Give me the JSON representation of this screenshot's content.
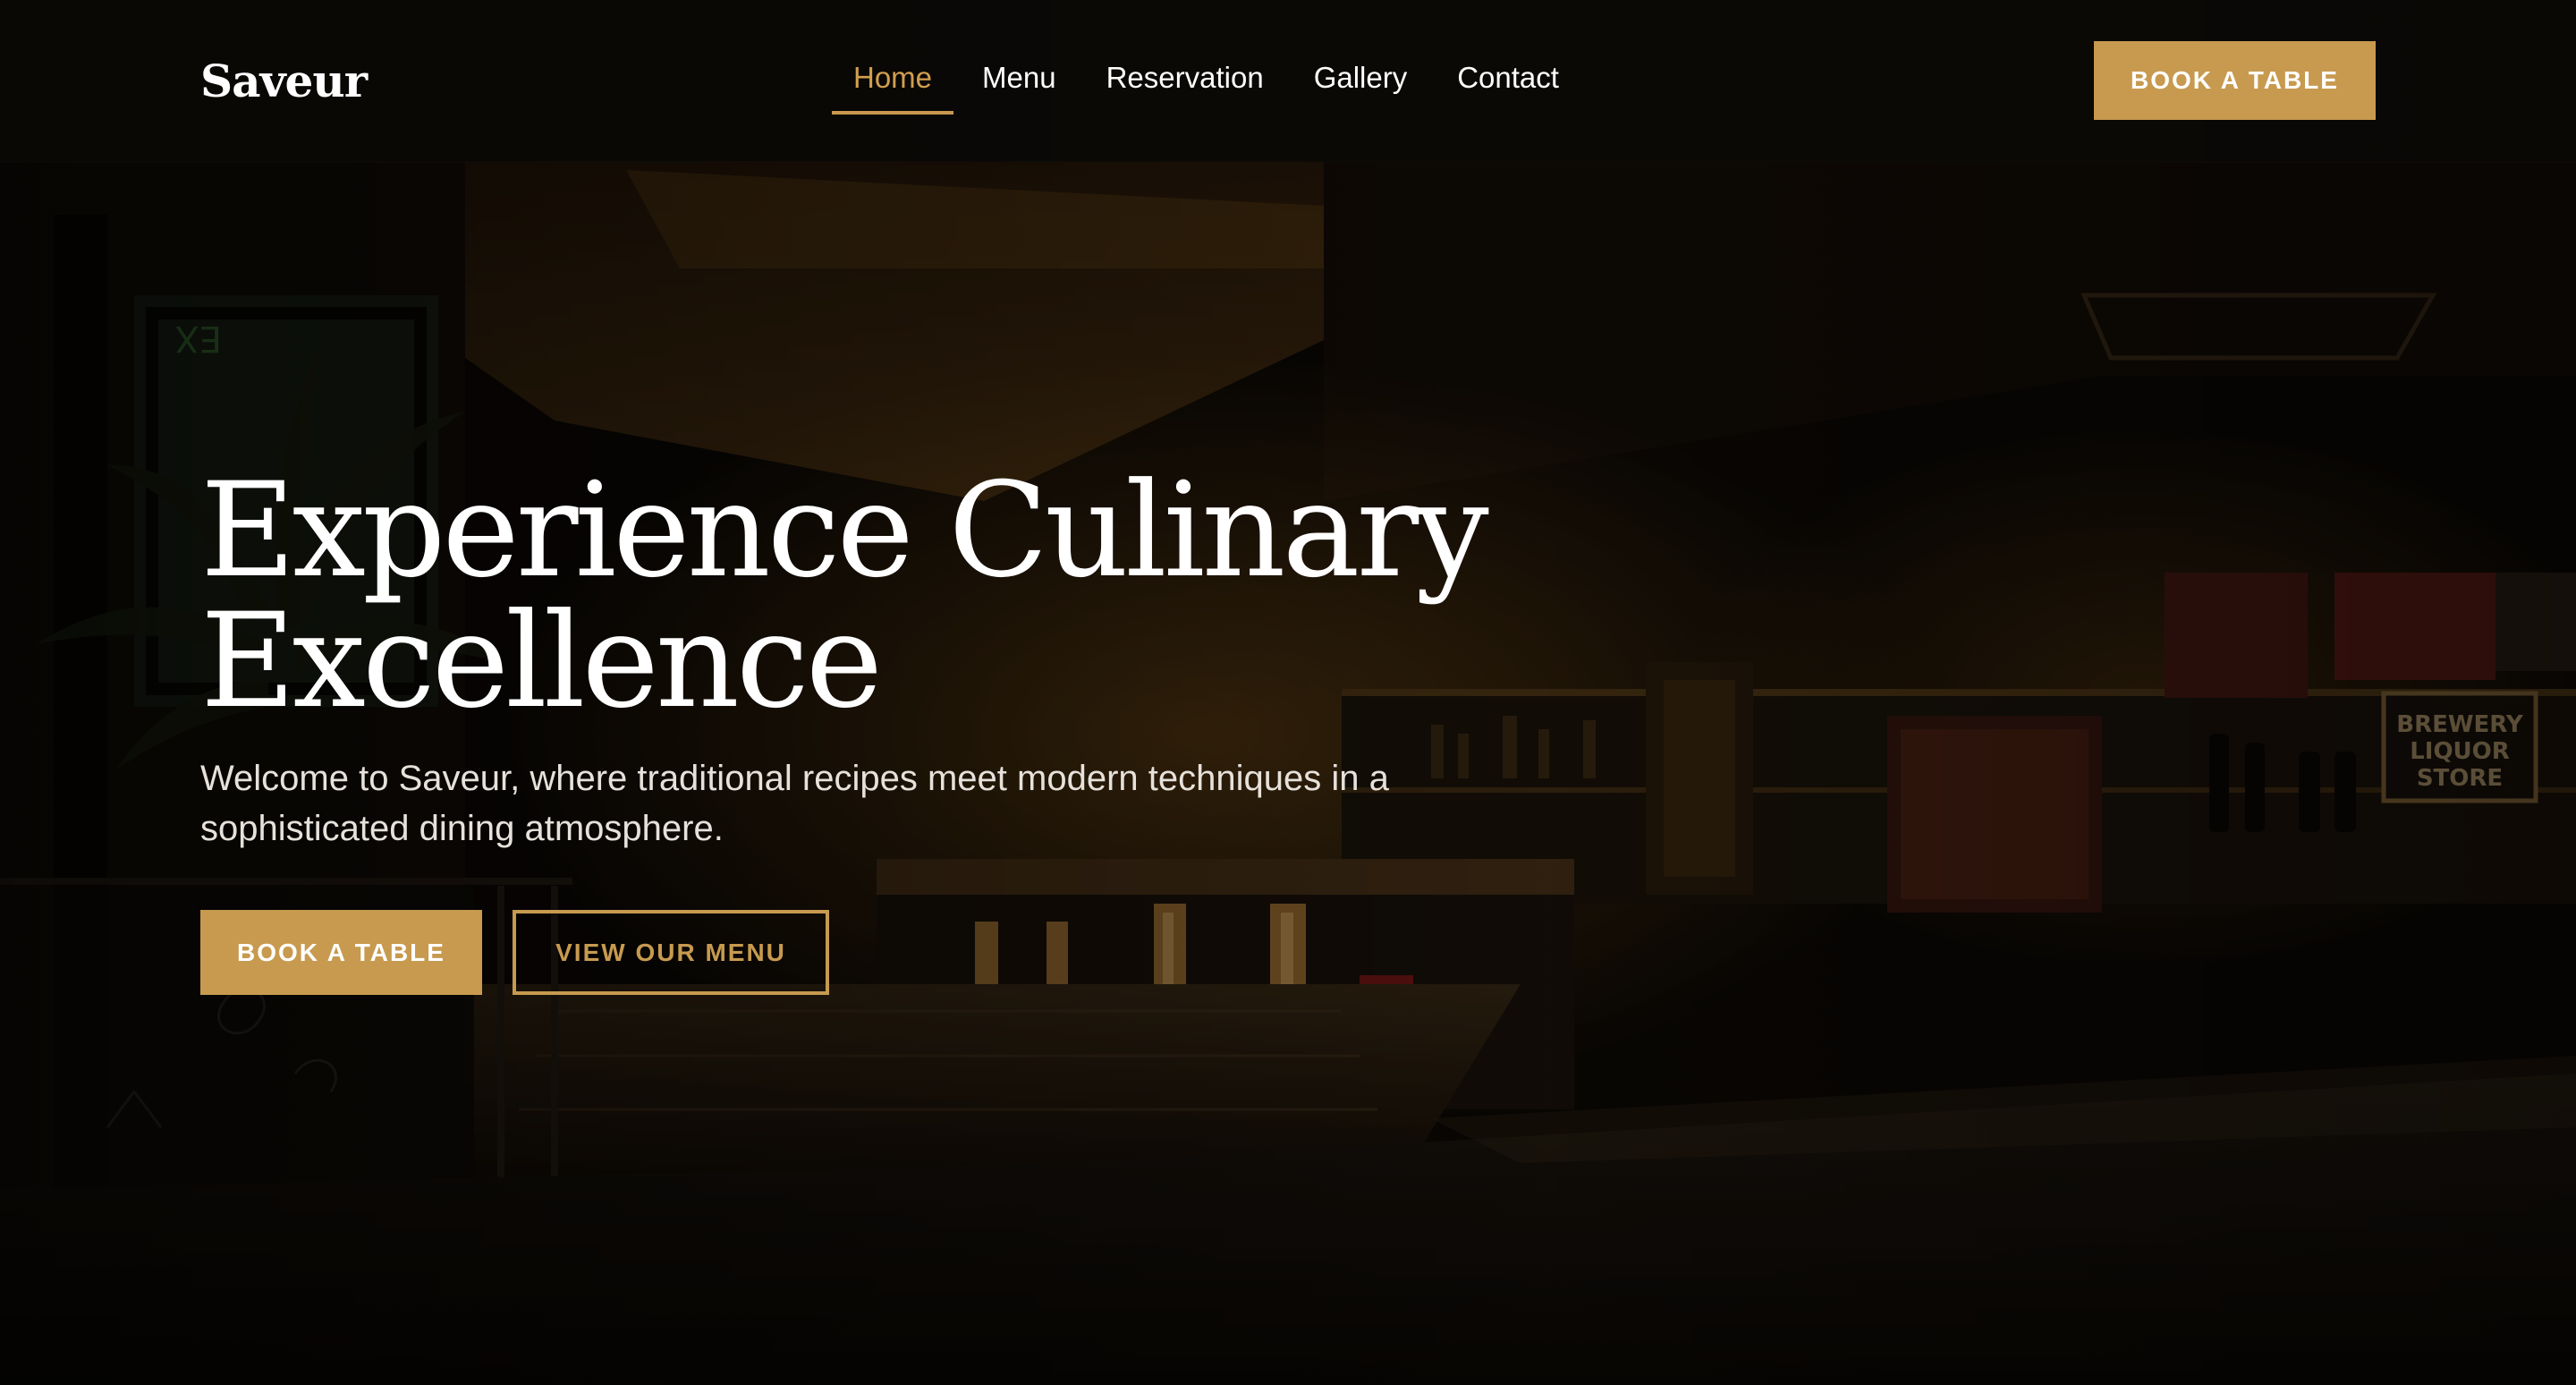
{
  "brand": {
    "logo_text": "Saveur",
    "accent_color": "#c79a4f"
  },
  "nav": {
    "items": [
      {
        "label": "Home",
        "active": true
      },
      {
        "label": "Menu",
        "active": false
      },
      {
        "label": "Reservation",
        "active": false
      },
      {
        "label": "Gallery",
        "active": false
      },
      {
        "label": "Contact",
        "active": false
      }
    ],
    "cta_label": "BOOK A TABLE"
  },
  "hero": {
    "title_line1": "Experience Culinary",
    "title_line2": "Excellence",
    "subtitle": "Welcome to Saveur, where traditional recipes meet modern techniques in a sophisticated dining atmosphere.",
    "primary_button": "BOOK A TABLE",
    "secondary_button": "VIEW OUR MENU",
    "background": "dark restaurant bar interior with warm lighting"
  }
}
